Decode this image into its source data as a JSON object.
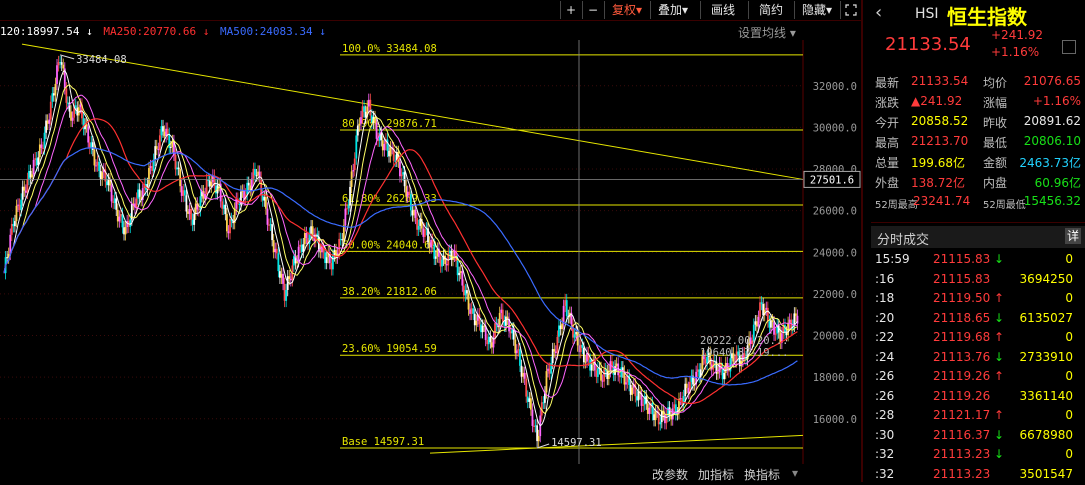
{
  "toolbar": {
    "plus": "+",
    "minus": "−",
    "fuquan": "复权",
    "fuquan_arrow": "▾",
    "diejia": "叠加",
    "diejia_arrow": "▾",
    "huaxian": "画线",
    "jianyue": "简约",
    "yincang": "隐藏",
    "yincang_arrow": "▾"
  },
  "ma": {
    "ma120": "120:18997.54",
    "ma250": "MA250:20770.66",
    "ma500": "MA500:24083.34",
    "arrow_down": "↓",
    "colors": {
      "ma120": "#ffffff",
      "ma250": "#ff3030",
      "ma500": "#3a6bff"
    }
  },
  "settings_label": "设置均线 ▾",
  "bottom": {
    "change_param": "改参数",
    "add_indicator": "加指标",
    "change_indicator": "换指标"
  },
  "header": {
    "code": "HSI",
    "name": "恒生指数",
    "price": "21133.54",
    "change": "+241.92",
    "change_pct": "+1.16%"
  },
  "quote": [
    {
      "l1": "最新",
      "v1": "21133.54",
      "c1": "red",
      "l2": "均价",
      "v2": "21076.65",
      "c2": "red"
    },
    {
      "l1": "涨跌",
      "v1": "▲241.92",
      "c1": "red",
      "l2": "涨幅",
      "v2": "+1.16%",
      "c2": "red"
    },
    {
      "l1": "今开",
      "v1": "20858.52",
      "c1": "yellow",
      "l2": "昨收",
      "v2": "20891.62",
      "c2": "white"
    },
    {
      "l1": "最高",
      "v1": "21213.70",
      "c1": "red",
      "l2": "最低",
      "v2": "20806.10",
      "c2": "green"
    },
    {
      "l1": "总量",
      "v1": "199.68亿",
      "c1": "yellow",
      "l2": "金额",
      "v2": "2463.73亿",
      "c2": "cyan"
    },
    {
      "l1": "外盘",
      "v1": "138.72亿",
      "c1": "red",
      "l2": "内盘",
      "v2": "60.96亿",
      "c2": "green"
    },
    {
      "l1": "52周最高",
      "v1": "23241.74",
      "c1": "red",
      "l2": "52周最低",
      "v2": "15456.32",
      "c2": "green"
    }
  ],
  "ticks_header": {
    "title": "分时成交",
    "detail": "详"
  },
  "ticks": [
    {
      "time": "15:59",
      "price": "21115.83",
      "arrow": "↓",
      "vol": "0",
      "vc": "yellow"
    },
    {
      "time": ":16",
      "price": "21115.83",
      "arrow": "",
      "vol": "3694250",
      "vc": "yellow"
    },
    {
      "time": ":18",
      "price": "21119.50",
      "arrow": "↑",
      "vol": "0",
      "vc": "yellow"
    },
    {
      "time": ":20",
      "price": "21118.65",
      "arrow": "↓",
      "vol": "6135027",
      "vc": "yellow"
    },
    {
      "time": ":22",
      "price": "21119.68",
      "arrow": "↑",
      "vol": "0",
      "vc": "yellow"
    },
    {
      "time": ":24",
      "price": "21113.76",
      "arrow": "↓",
      "vol": "2733910",
      "vc": "yellow"
    },
    {
      "time": ":26",
      "price": "21119.26",
      "arrow": "↑",
      "vol": "0",
      "vc": "yellow"
    },
    {
      "time": ":26",
      "price": "21119.26",
      "arrow": "",
      "vol": "3361140",
      "vc": "yellow"
    },
    {
      "time": ":28",
      "price": "21121.17",
      "arrow": "↑",
      "vol": "0",
      "vc": "yellow"
    },
    {
      "time": ":30",
      "price": "21116.37",
      "arrow": "↓",
      "vol": "6678980",
      "vc": "yellow"
    },
    {
      "time": ":32",
      "price": "21113.23",
      "arrow": "↓",
      "vol": "0",
      "vc": "yellow"
    },
    {
      "time": ":32",
      "price": "21113.23",
      "arrow": "",
      "vol": "3501547",
      "vc": "yellow"
    }
  ],
  "chart_data": {
    "type": "candlestick",
    "title": "",
    "y_ticks": [
      32000,
      30000,
      28000,
      26000,
      24000,
      22000,
      20000,
      18000,
      16000
    ],
    "y_tick_labels": [
      "32000.0",
      "30000.0",
      "28000.0",
      "26000.0",
      "24000.0",
      "22000.0",
      "20000.0",
      "18000.0",
      "16000.0"
    ],
    "ylim": [
      14500,
      34200
    ],
    "crosshair_value": "27501.6",
    "fib_levels": [
      {
        "label": "100.0%  33484.08",
        "value": 33484.08
      },
      {
        "label": "80.90%  29876.71",
        "value": 29876.71
      },
      {
        "label": "61.80%  26269.33",
        "value": 26269.33
      },
      {
        "label": "50.00%  24040.69",
        "value": 24040.69
      },
      {
        "label": "38.20%  21812.06",
        "value": 21812.06
      },
      {
        "label": "23.60%  19054.59",
        "value": 19054.59
      },
      {
        "label": "Base   14597.31",
        "value": 14597.31
      }
    ],
    "annotations": {
      "high": "33484.08",
      "low": "14597.31",
      "box1": "20222.00-20...",
      "box2": "19640.37-19..."
    },
    "price_path": [
      23000,
      25500,
      26800,
      28000,
      29000,
      31000,
      33484,
      30500,
      31000,
      29500,
      28000,
      27500,
      26000,
      25000,
      26500,
      27000,
      28500,
      30000,
      29000,
      27000,
      25500,
      26500,
      27500,
      27000,
      25000,
      26500,
      27000,
      28000,
      26000,
      24000,
      22000,
      23500,
      24500,
      25000,
      24000,
      23500,
      24500,
      27000,
      30500,
      31000,
      29500,
      29000,
      28500,
      27000,
      25500,
      25000,
      24000,
      23500,
      24000,
      22500,
      21000,
      20500,
      19500,
      21000,
      20500,
      19000,
      17000,
      15000,
      18000,
      19500,
      21500,
      20000,
      19000,
      18500,
      18000,
      18500,
      18200,
      17500,
      17000,
      16500,
      16000,
      16200,
      16500,
      17500,
      18000,
      19000,
      18500,
      18200,
      19000,
      18800,
      20000,
      21500,
      20500,
      20000,
      20500,
      21000
    ]
  }
}
